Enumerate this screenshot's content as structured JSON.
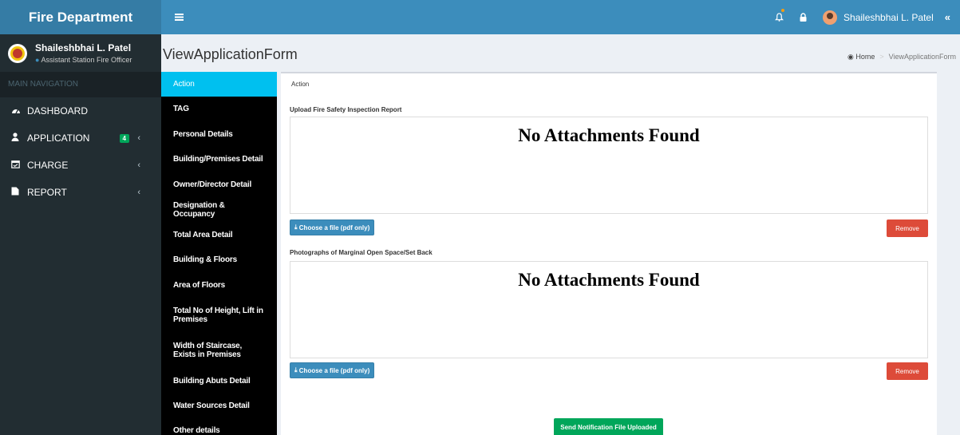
{
  "app": {
    "title": "Fire Department"
  },
  "topbar": {
    "menu_icon": "bars-icon",
    "user_name": "Shaileshbhai L. Patel",
    "collapse_glyph": "«"
  },
  "sidebar": {
    "user": {
      "name": "Shaileshbhai L. Patel",
      "role": "Assistant Station Fire Officer"
    },
    "nav_header": "MAIN NAVIGATION",
    "items": [
      {
        "label": "DASHBOARD",
        "icon": "dashboard-icon"
      },
      {
        "label": "APPLICATION",
        "icon": "user-icon",
        "badge": "4"
      },
      {
        "label": "CHARGE",
        "icon": "calendar-icon"
      },
      {
        "label": "REPORT",
        "icon": "file-icon"
      }
    ]
  },
  "page": {
    "title": "ViewApplicationForm",
    "breadcrumb": {
      "home": "Home",
      "current": "ViewApplicationForm"
    }
  },
  "tabs": [
    "Action",
    "TAG",
    "Personal Details",
    "Building/Premises Detail",
    "Owner/Director Detail",
    "Designation & Occupancy",
    "Total Area Detail",
    "Building & Floors",
    "Area of Floors",
    "Total No of Height, Lift in Premises",
    "Width of Staircase, Exists in Premises",
    "Building Abuts Detail",
    "Water Sources Detail",
    "Other details"
  ],
  "main": {
    "box_title": "Action",
    "sections": [
      {
        "label": "Upload Fire Safety Inspection Report",
        "empty_message": "No Attachments Found",
        "choose_label": "Choose a file (pdf only)",
        "remove_label": "Remove"
      },
      {
        "label": "Photographs of Marginal Open Space/Set Back",
        "empty_message": "No Attachments Found",
        "choose_label": "Choose a file (pdf only)",
        "remove_label": "Remove"
      }
    ],
    "send_label": "Send Notification File Uploaded"
  },
  "colors": {
    "header": "#3c8dbc",
    "logo": "#357ca5",
    "sidebar": "#222d32",
    "tab_active": "#00c0ef",
    "remove": "#dd4b39",
    "send": "#00a65a"
  }
}
